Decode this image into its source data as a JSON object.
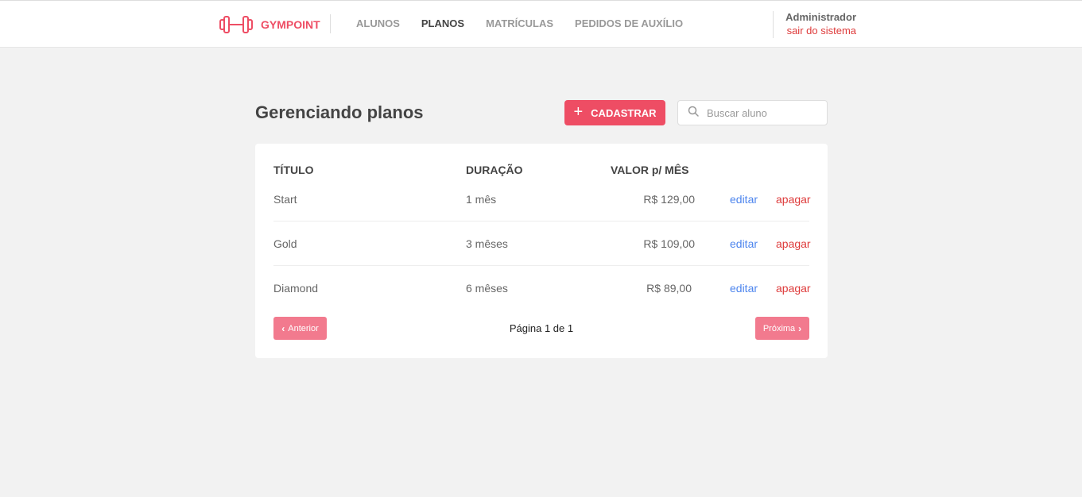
{
  "header": {
    "brand": "GYMPOINT",
    "nav": [
      {
        "label": "ALUNOS",
        "active": false
      },
      {
        "label": "PLANOS",
        "active": true
      },
      {
        "label": "MATRÍCULAS",
        "active": false
      },
      {
        "label": "PEDIDOS DE AUXÍLIO",
        "active": false
      }
    ],
    "user_name": "Administrador",
    "logout_label": "sair do sistema"
  },
  "main": {
    "title": "Gerenciando planos",
    "add_label": "CADASTRAR",
    "search_placeholder": "Buscar aluno"
  },
  "table": {
    "headers": {
      "title": "TÍTULO",
      "duration": "DURAÇÃO",
      "price": "VALOR p/ MÊS"
    },
    "rows": [
      {
        "title": "Start",
        "duration": "1 mês",
        "price": "R$ 129,00",
        "edit": "editar",
        "delete": "apagar"
      },
      {
        "title": "Gold",
        "duration": "3 mêses",
        "price": "R$ 109,00",
        "edit": "editar",
        "delete": "apagar"
      },
      {
        "title": "Diamond",
        "duration": "6 mêses",
        "price": "R$ 89,00",
        "edit": "editar",
        "delete": "apagar"
      }
    ]
  },
  "pagination": {
    "prev_label": "Anterior",
    "next_label": "Próxima",
    "info": "Página 1 de 1"
  },
  "colors": {
    "accent": "#ee4d64",
    "edit_link": "#4d85ee",
    "delete_link": "#de3b3b",
    "background": "#f2f2f2"
  },
  "icons": {
    "logo": "dumbbell-icon",
    "add": "plus-icon",
    "search": "search-icon",
    "prev": "chevron-left-icon",
    "next": "chevron-right-icon"
  }
}
